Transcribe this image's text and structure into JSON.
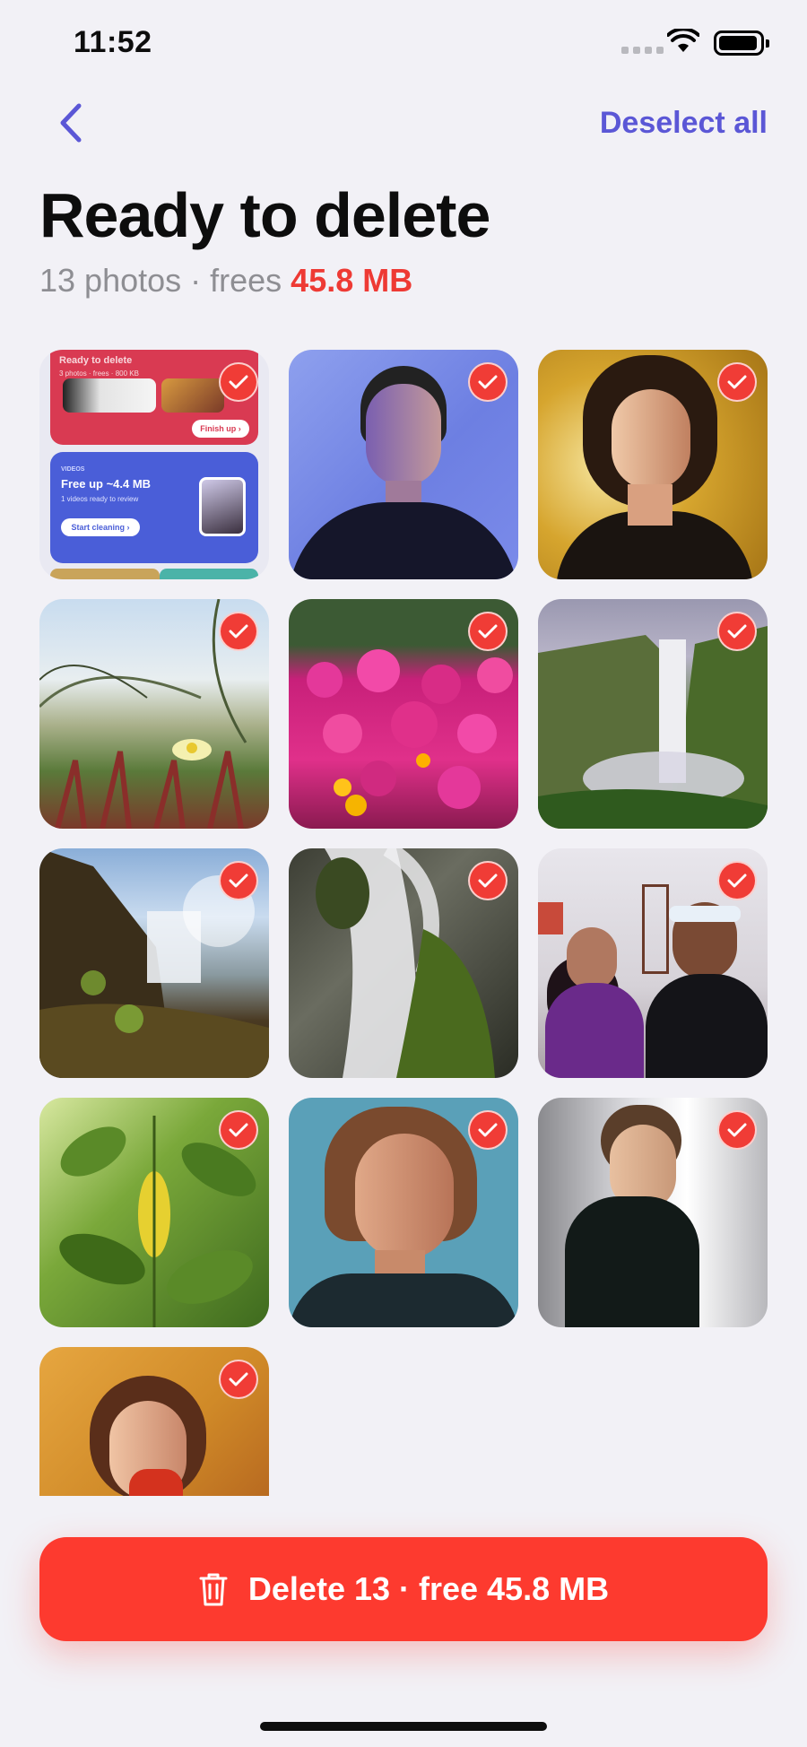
{
  "status_bar": {
    "time": "11:52"
  },
  "nav": {
    "back_icon": "chevron-left-icon",
    "deselect_label": "Deselect all"
  },
  "header": {
    "title": "Ready to delete",
    "subtitle_prefix": "13 photos · frees ",
    "subtitle_size": "45.8 MB"
  },
  "photos": [
    {
      "desc": "app-screenshot",
      "selected": true
    },
    {
      "desc": "portrait-blue",
      "selected": true
    },
    {
      "desc": "portrait-curly",
      "selected": true
    },
    {
      "desc": "grass-flower",
      "selected": true
    },
    {
      "desc": "pink-flowers",
      "selected": true
    },
    {
      "desc": "waterfall-cliff",
      "selected": true
    },
    {
      "desc": "waterfall-sunset",
      "selected": true
    },
    {
      "desc": "waterfall-rocks",
      "selected": true
    },
    {
      "desc": "couple-selfie",
      "selected": true
    },
    {
      "desc": "green-leaves",
      "selected": true
    },
    {
      "desc": "portrait-teal",
      "selected": true
    },
    {
      "desc": "portrait-turtleneck",
      "selected": true
    },
    {
      "desc": "portrait-orange",
      "selected": true
    }
  ],
  "screenshot_thumb": {
    "card1_title": "Ready to delete",
    "card1_sub": "3 photos · frees · 800 KB",
    "card1_btn": "Finish up ›",
    "card2_tag": "VIDEOS",
    "card2_title": "Free up ~4.4 MB",
    "card2_sub": "1 videos ready to review",
    "card2_btn": "Start cleaning ›"
  },
  "actions": {
    "delete_icon": "trash-icon",
    "delete_label": "Delete 13 · free 45.8 MB"
  },
  "colors": {
    "accent": "#5b57d6",
    "danger": "#fd3a2f",
    "background": "#f2f1f6"
  }
}
